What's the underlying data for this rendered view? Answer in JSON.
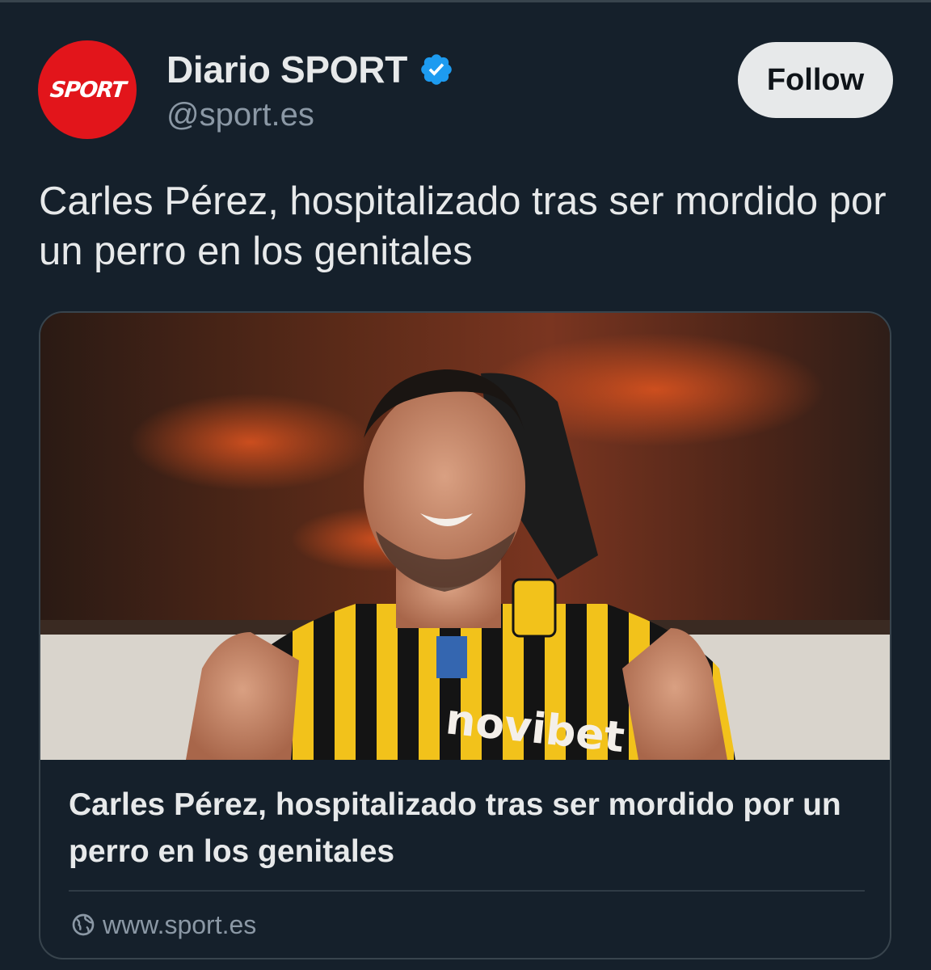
{
  "account": {
    "avatar_text": "SPORT",
    "display_name": "Diario SPORT",
    "handle": "@sport.es",
    "verified_icon": "verified-badge-icon"
  },
  "follow_button": {
    "label": "Follow"
  },
  "tweet": {
    "text": "Carles Pérez, hospitalizado tras ser mordido por un perro en los genitales"
  },
  "card": {
    "image_alt": "Football player smiling in a black and yellow striped Aris jersey",
    "jersey_sponsor": "novibet",
    "title": "Carles Pérez, hospitalizado tras ser mordido por un perro en los genitales",
    "source_icon": "globe-icon",
    "url": "www.sport.es"
  },
  "colors": {
    "background": "#15202b",
    "primary_text": "#e7e9ea",
    "secondary_text": "#8b98a5",
    "border": "#38444d",
    "avatar_red": "#e2151b",
    "verified_blue": "#1d9bf0",
    "follow_bg": "#e7e9ea"
  }
}
